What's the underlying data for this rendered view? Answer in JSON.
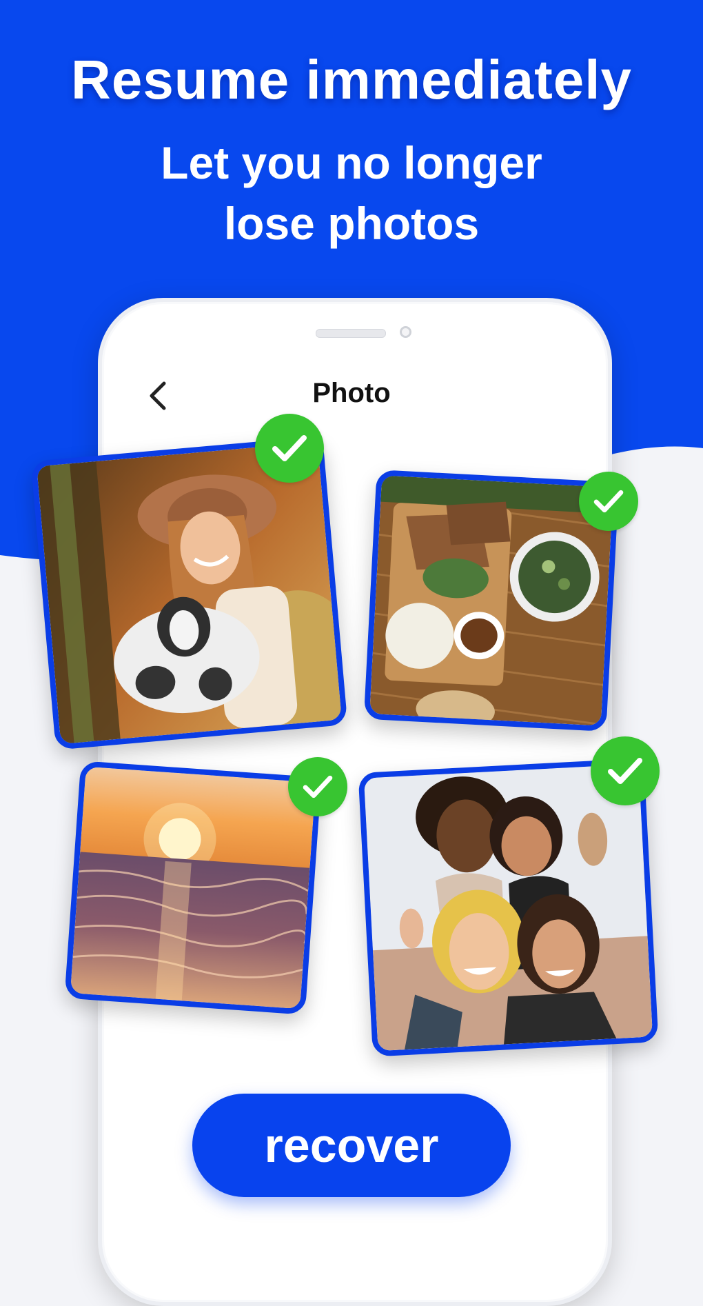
{
  "header": {
    "headline": "Resume immediately",
    "subline": "Let you no longer\nlose photos"
  },
  "screen": {
    "title": "Photo",
    "back_icon": "chevron-left-icon"
  },
  "photos": [
    {
      "name": "woman-with-goat",
      "selected": true
    },
    {
      "name": "food-platter",
      "selected": true
    },
    {
      "name": "sunset-sea",
      "selected": true
    },
    {
      "name": "friends-selfie",
      "selected": true
    }
  ],
  "actions": {
    "recover_label": "recover"
  },
  "colors": {
    "brand_blue": "#0843ee",
    "check_green": "#38c531",
    "background": "#f3f4f8"
  }
}
